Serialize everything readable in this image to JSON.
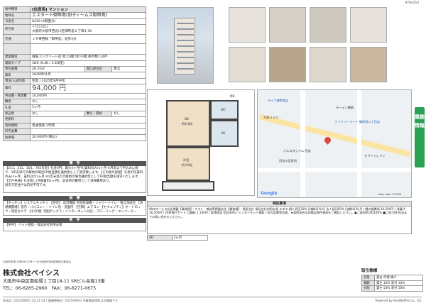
{
  "doc_id": "9784353",
  "spec": {
    "type_k": "物件種目",
    "type_v": "[住居用] マンション",
    "name_k": "物件名",
    "name_v": "エスタート御幣島(旧ディームス御幣島)",
    "room_k": "号室名",
    "room_v": "0410 (4階部分)",
    "addr_k": "所在地",
    "postal": "〒555-0012",
    "addr": "大阪府大阪市西淀川区御幣島２丁目3-39",
    "traffic_k": "交通",
    "traffic": "ＪＲ東西線「御幣島」徒歩3分",
    "structure_k": "建築構造",
    "structure": "鉄筋コンクリート造 地上9階 地下0階 総戸数114戸",
    "layout_k": "間取タイプ",
    "layout": "1DK (6.4K / 3.8洋室)",
    "area_k": "専有面積",
    "area": "28.35㎡",
    "balcony_k": "開口部方位",
    "balcony": "西北",
    "built_k": "築年",
    "built": "2020年01月",
    "status_k": "現況/入居時期",
    "status": "空室 / 2025年9月中旬",
    "rent_k": "賃料",
    "rent": "94,000 円",
    "mgmt_k": "共益費・管理費",
    "mgmt": "10,000円",
    "deposit_k": "敷金",
    "deposit": "なし",
    "key_k": "礼金",
    "key": "1ヶ月",
    "guarantee_k": "保証金",
    "guarantee": "なし",
    "shokyaku_k": "敷引・償却",
    "shokyaku": "なし",
    "renewal_k": "更新料",
    "renewal": "",
    "contract_k": "契約期間",
    "contract": "普通借家 2年間",
    "insurance_k": "町内会費",
    "insurance": "",
    "extra_k": "駐車場",
    "extra": "20,000円 (税込)"
  },
  "notes": {
    "title": "備　考",
    "text": "【211、311、303、705号室】礼金0円、最大4ヶ月FR(賃料のみ)1ヶ月 ※月末まで申込みに限り、1年未満での解約の場合FR相当額を違約金として請求致します。【その他の部屋】礼金0円(賃料のみ)1ヶ月、賃料ほか1ヶ月 ※1年未満での解約の場合違約金としてFR相当額を請求いたします。【全戸共通】礼金無し(月額賃料1ヶ月)、退去時の費用として清掃費用あり。",
    "note2": "退去予定住戸は内見不可です。"
  },
  "equip": {
    "title": "設　備",
    "text": "【キッチン】システムキッチン 【浴室】 追焚機能 浴室乾燥機・シャワートイレ・独立洗面台 【洗濯機置場】室内・バルコニー・トイレ別・洗面所 【空調】エアコン 【セキュリティ】オートロック・防犯カメラ 【その他】宅配ボックス・インターネット対応・フローリング・エレベーター"
  },
  "cond": {
    "title": "条　件",
    "text": "【条件】 ペット相談・保証会社利用必須"
  },
  "map_labels": [
    "ファミリーマート 御幣島二丁目店",
    "ライフ御幣島店",
    "ラーメン横綱",
    "大阪メトロ",
    "西淀川区役所",
    "セブンイレブン",
    "パルスタジアム 西淀",
    "Map data ©2025",
    "Google"
  ],
  "plan_labels": {
    "dk": "DK",
    "dk_size": "約6.4帖",
    "western": "洋室",
    "western_size": "約3.8帖",
    "mb": "MB",
    "wc": "WC",
    "ub": "UB"
  },
  "remarks": {
    "title": "特記事項",
    "text": "Webサービス広告掲載【業務提】・チラシ・雑誌等掲載広告【業務提】・保証会社 保証会社利用必須 エポス 個人初回30% 月額料1%/月 法人初回50% 月額料1%/月 / 鍵交換費用 16,500円 / 消毒代 16,500円 / 24時間サポート 月額料 1,100円 / 家賃保証 初回30% / インターネット無料 / 町内会費等別途。★契約条件の詳細は物件資料をご確認ください。●ご成約時:AD100% ■ご紹介時:担当までお問い合わせください。"
  },
  "period": {
    "k": "AD",
    "v": "2ヶ月"
  },
  "side_tab": "業務情報",
  "company": {
    "notice": "大阪府知事(3)第58012号 (一社)大阪府宅地建物取引業協会",
    "name": "株式会社ベイシス",
    "address": "大阪市中央区南船場１丁目18-11 SRビル長堀13階",
    "tel": "TEL：06-6265-2960　FAX：06-6271-0675"
  },
  "torihiki": {
    "title": "取引態様",
    "kind_k": "形態",
    "kind": "貸主 代理 媒介",
    "rate_k": "報酬",
    "rate": "貸主 10% 客付 10%",
    "ratio_k": "分配",
    "ratio": "貸主 50% 客付 50%"
  },
  "footer": {
    "left": "作成日: 2025/09/01 10:21:54 / 情報更新日: 2025/09/01 ※情報取得時点の情報です",
    "right": "Powered by RealNetPro co., ltd."
  }
}
